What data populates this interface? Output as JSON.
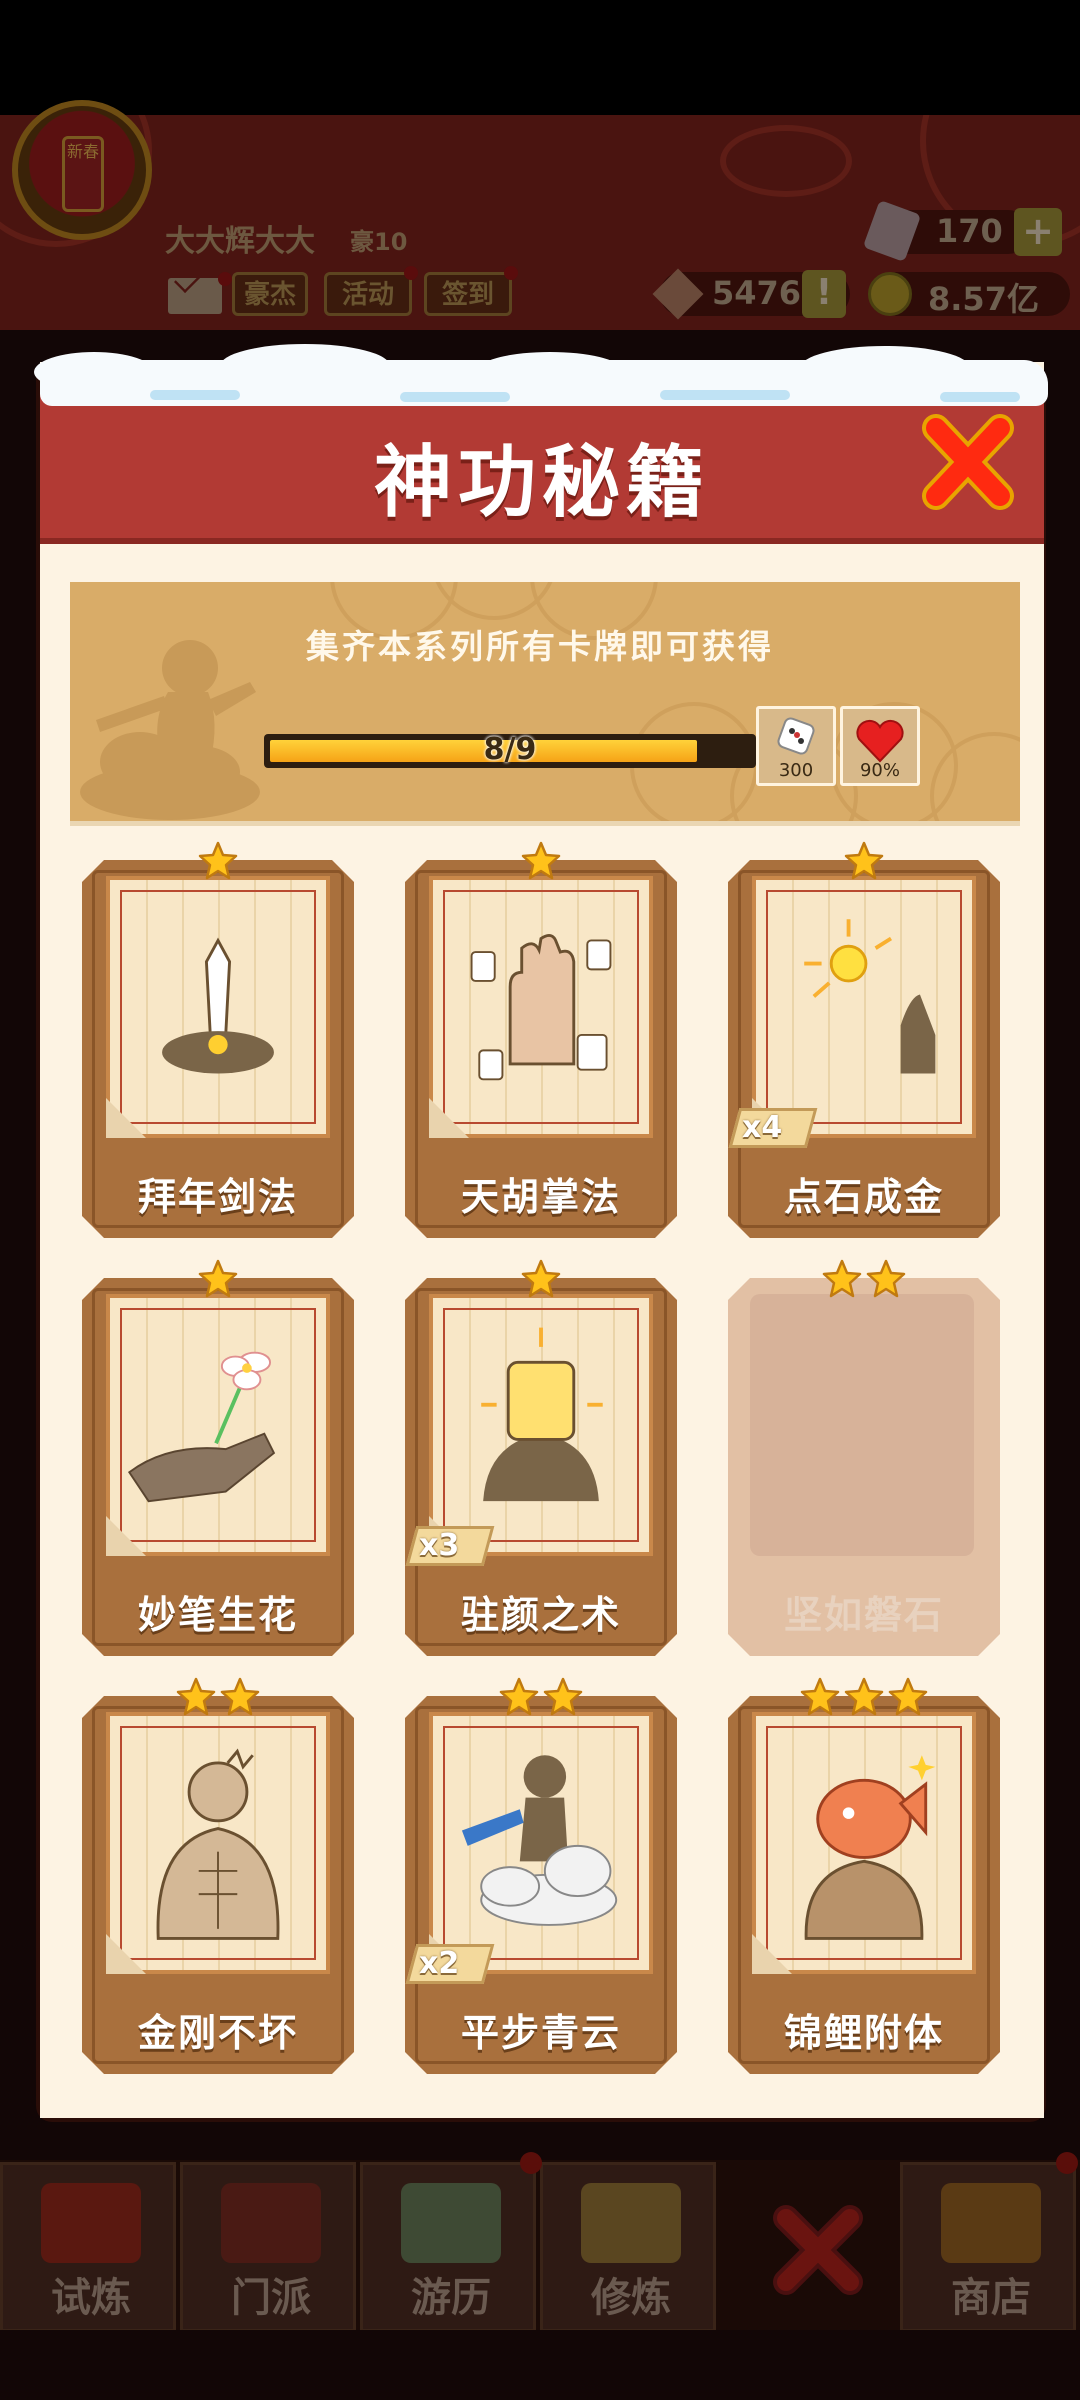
{
  "hud": {
    "player_name": "大大辉大大",
    "player_level": "豪10",
    "buttons": [
      {
        "label": "豪杰",
        "icon": "hero-button"
      },
      {
        "label": "活动",
        "icon": "event-button"
      },
      {
        "label": "签到",
        "icon": "checkin-button"
      }
    ],
    "gems": "170",
    "tokens": "5476",
    "gold": "8.57亿",
    "avatar_tag": "新春"
  },
  "dialog": {
    "title": "神功秘籍",
    "banner_text": "集齐本系列所有卡牌即可获得",
    "progress": {
      "current": 8,
      "total": 9,
      "label": "8/9"
    },
    "rewards": [
      {
        "icon": "dice-icon",
        "value": "300"
      },
      {
        "icon": "heart-icon",
        "value": "90%"
      }
    ]
  },
  "cards": [
    {
      "name": "拜年剑法",
      "stars": 1,
      "count": "",
      "owned": true,
      "icon": "sword-card-art"
    },
    {
      "name": "天胡掌法",
      "stars": 1,
      "count": "",
      "owned": true,
      "icon": "palm-mahjong-card-art"
    },
    {
      "name": "点石成金",
      "stars": 1,
      "count": "x4",
      "owned": true,
      "icon": "finger-gold-card-art"
    },
    {
      "name": "妙笔生花",
      "stars": 1,
      "count": "",
      "owned": true,
      "icon": "hand-flower-card-art"
    },
    {
      "name": "驻颜之术",
      "stars": 1,
      "count": "x3",
      "owned": true,
      "icon": "face-mask-card-art"
    },
    {
      "name": "坚如磐石",
      "stars": 2,
      "count": "",
      "owned": false,
      "icon": "locked-card-art"
    },
    {
      "name": "金刚不坏",
      "stars": 2,
      "count": "",
      "owned": true,
      "icon": "muscle-man-card-art"
    },
    {
      "name": "平步青云",
      "stars": 2,
      "count": "x2",
      "owned": true,
      "icon": "cloud-rider-card-art"
    },
    {
      "name": "锦鲤附体",
      "stars": 3,
      "count": "",
      "owned": true,
      "icon": "koi-head-card-art"
    }
  ],
  "nav": [
    {
      "label": "试炼",
      "icon": "trial-icon"
    },
    {
      "label": "门派",
      "icon": "sect-icon"
    },
    {
      "label": "游历",
      "icon": "travel-icon"
    },
    {
      "label": "修炼",
      "icon": "training-icon"
    },
    {
      "label": "",
      "icon": "close-icon"
    },
    {
      "label": "商店",
      "icon": "shop-icon"
    }
  ],
  "colors": {
    "header_red": "#b23a34",
    "dialog_bg": "#fdf3e3",
    "banner_tan": "#d9ac68",
    "card_brown": "#a9703d",
    "progress_gold": "#ffb020",
    "close_red": "#ff2a10"
  }
}
